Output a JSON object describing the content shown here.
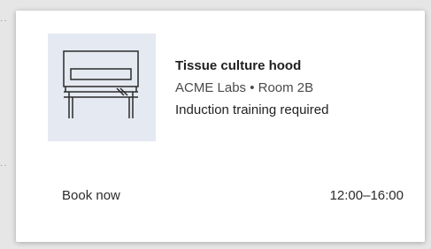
{
  "card": {
    "thumbnail_icon": "tissue-culture-hood-illustration",
    "title": "Tissue culture hood",
    "location": "ACME Labs • Room 2B",
    "note": "Induction training required",
    "action_label": "Book now",
    "time_range": "12:00–16:00"
  },
  "colors": {
    "thumbnail_bg": "#e5e9f1",
    "card_bg": "#ffffff"
  }
}
